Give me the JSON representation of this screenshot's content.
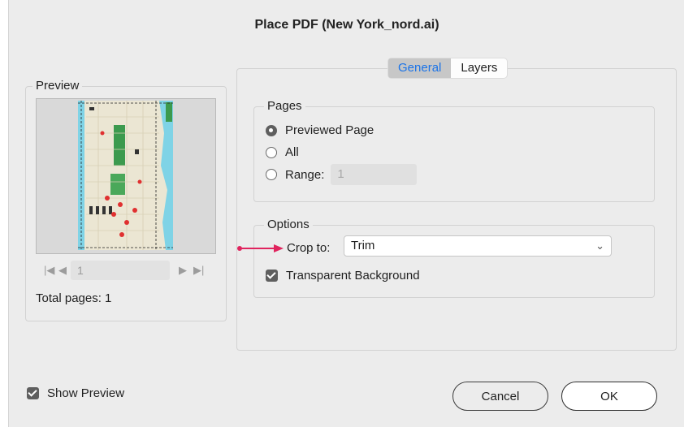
{
  "title": "Place PDF (New York_nord.ai)",
  "preview": {
    "legend": "Preview",
    "page_value": "1",
    "total_pages": "Total pages: 1",
    "icons": [
      "first-page-icon",
      "prev-page-icon",
      "next-page-icon",
      "last-page-icon"
    ]
  },
  "tabs": [
    {
      "label": "General",
      "active": true
    },
    {
      "label": "Layers",
      "active": false
    }
  ],
  "pages": {
    "legend": "Pages",
    "options": [
      {
        "label": "Previewed Page",
        "checked": true
      },
      {
        "label": "All",
        "checked": false
      },
      {
        "label": "Range:",
        "checked": false
      }
    ],
    "range_value": "1"
  },
  "options": {
    "legend": "Options",
    "crop_label": "Crop to:",
    "crop_value": "Trim",
    "transparent_label": "Transparent Background",
    "transparent_checked": true
  },
  "footer": {
    "show_preview_label": "Show Preview",
    "show_preview_checked": true,
    "cancel_label": "Cancel",
    "ok_label": "OK"
  },
  "colors": {
    "annotation_arrow": "#e0245e",
    "active_tab_text": "#1a73e8"
  }
}
